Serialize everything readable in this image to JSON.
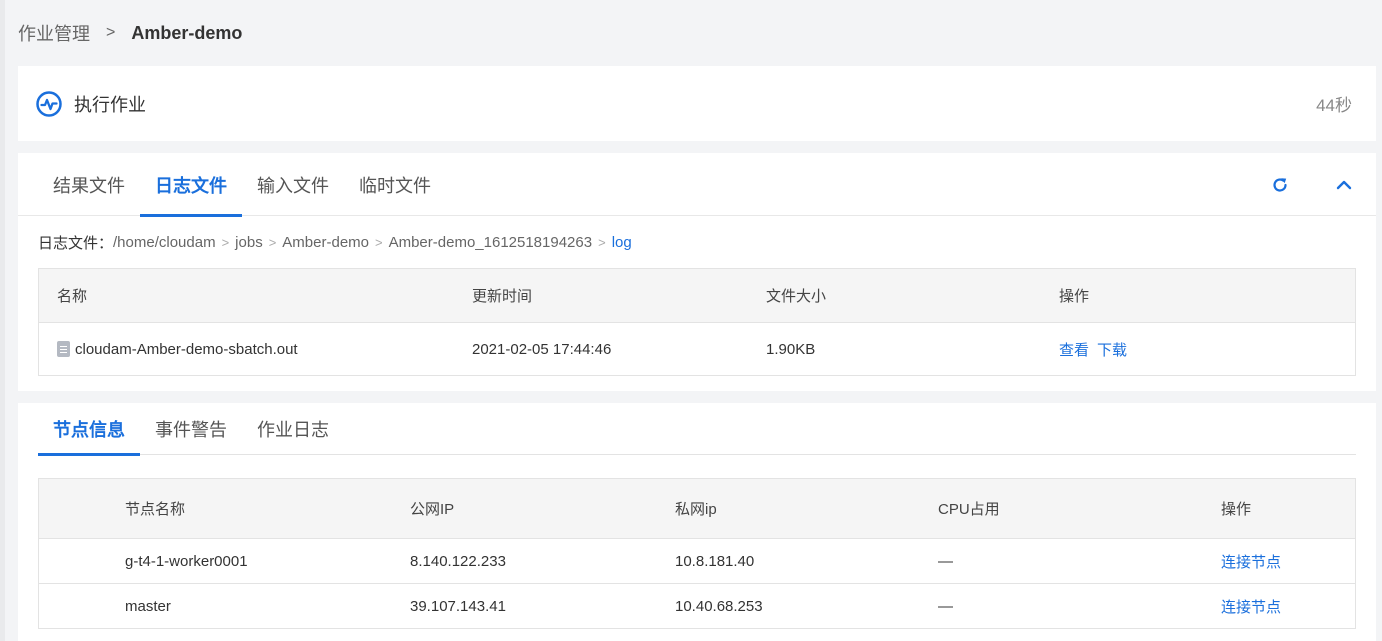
{
  "breadcrumb": {
    "parent": "作业管理",
    "separator": ">",
    "current": "Amber-demo"
  },
  "status": {
    "icon": "activity-pulse-icon",
    "title": "执行作业",
    "duration": "44秒"
  },
  "file_tabs": [
    {
      "label": "结果文件",
      "active": false
    },
    {
      "label": "日志文件",
      "active": true
    },
    {
      "label": "输入文件",
      "active": false
    },
    {
      "label": "临时文件",
      "active": false
    }
  ],
  "file_tab_actions": {
    "refresh_icon": "refresh-icon",
    "collapse_icon": "chevron-up-icon"
  },
  "path": {
    "label": "日志文件：",
    "segments": [
      "/home/cloudam",
      "jobs",
      "Amber-demo",
      "Amber-demo_1612518194263",
      "log"
    ]
  },
  "file_table": {
    "headers": [
      "名称",
      "更新时间",
      "文件大小",
      "操作"
    ],
    "rows": [
      {
        "name": "cloudam-Amber-demo-sbatch.out",
        "updated": "2021-02-05 17:44:46",
        "size": "1.90KB",
        "actions": [
          "查看",
          "下载"
        ]
      }
    ]
  },
  "node_tabs": [
    {
      "label": "节点信息",
      "active": true
    },
    {
      "label": "事件警告",
      "active": false
    },
    {
      "label": "作业日志",
      "active": false
    }
  ],
  "node_table": {
    "headers": [
      "节点名称",
      "公网IP",
      "私网ip",
      "CPU占用",
      "操作"
    ],
    "rows": [
      {
        "name": "g-t4-1-worker0001",
        "public_ip": "8.140.122.233",
        "private_ip": "10.8.181.40",
        "cpu": "—",
        "action": "连接节点"
      },
      {
        "name": "master",
        "public_ip": "39.107.143.41",
        "private_ip": "10.40.68.253",
        "cpu": "—",
        "action": "连接节点"
      }
    ]
  },
  "colors": {
    "accent": "#1a6fdc",
    "background": "#f3f4f6",
    "file_icon": "#b4b9c2"
  }
}
